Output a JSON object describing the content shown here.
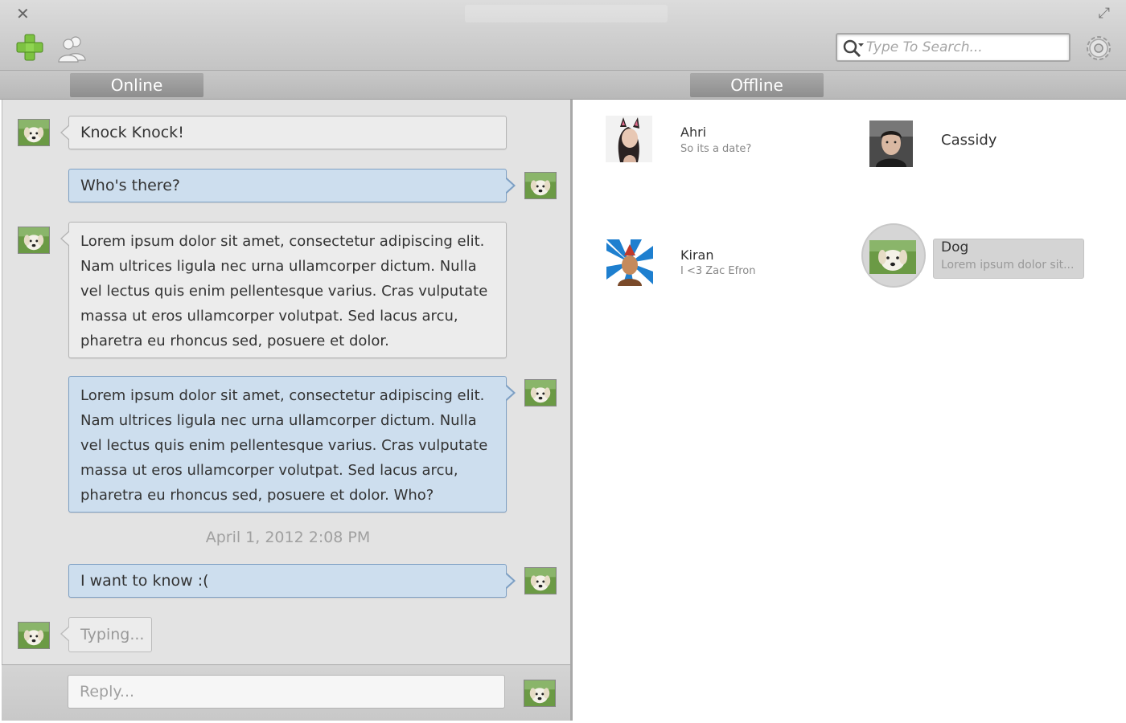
{
  "titlebar": {
    "close_glyph": "✕",
    "maximize_glyph": "⤢"
  },
  "toolbar": {
    "add_icon": "plus-icon",
    "contacts_icon": "contacts-icon",
    "search_placeholder": "Type To Search...",
    "settings_icon": "gear-icon"
  },
  "tabs": [
    {
      "label": "Online"
    },
    {
      "label": "Offline"
    }
  ],
  "chat": {
    "messages": [
      {
        "side": "left",
        "text": "Knock Knock!"
      },
      {
        "side": "right",
        "text": "Who's there?"
      },
      {
        "side": "left",
        "text": "Lorem ipsum dolor sit amet, consectetur adipiscing elit. Nam ultrices ligula nec urna ullamcorper dictum. Nulla vel lectus quis enim pellentesque varius. Cras vulputate massa ut eros ullamcorper volutpat. Sed lacus arcu, pharetra eu rhoncus sed, posuere et dolor."
      },
      {
        "side": "right",
        "text": "Lorem ipsum dolor sit amet, consectetur adipiscing elit. Nam ultrices ligula nec urna ullamcorper dictum. Nulla vel lectus quis enim pellentesque varius. Cras vulputate massa ut eros ullamcorper volutpat. Sed lacus arcu, pharetra eu rhoncus sed, posuere et dolor. Who?"
      },
      {
        "side": "right",
        "text": "I want to know :("
      }
    ],
    "timestamp": "April 1, 2012 2:08 PM",
    "typing": "Typing...",
    "reply_placeholder": "Reply..."
  },
  "contacts": [
    {
      "name": "Ahri",
      "status": "So its a date?"
    },
    {
      "name": "Cassidy",
      "status": ""
    },
    {
      "name": "Kiran",
      "status": "I <3 Zac Efron"
    },
    {
      "name": "Dog",
      "status": "Lorem ipsum dolor sit..."
    }
  ],
  "colors": {
    "bubble_outgoing": "#cddeee",
    "bubble_outgoing_border": "#7ea0c4",
    "bubble_incoming": "#ececec",
    "tab": "#9c9c9c",
    "add_icon": "#7dc242"
  }
}
